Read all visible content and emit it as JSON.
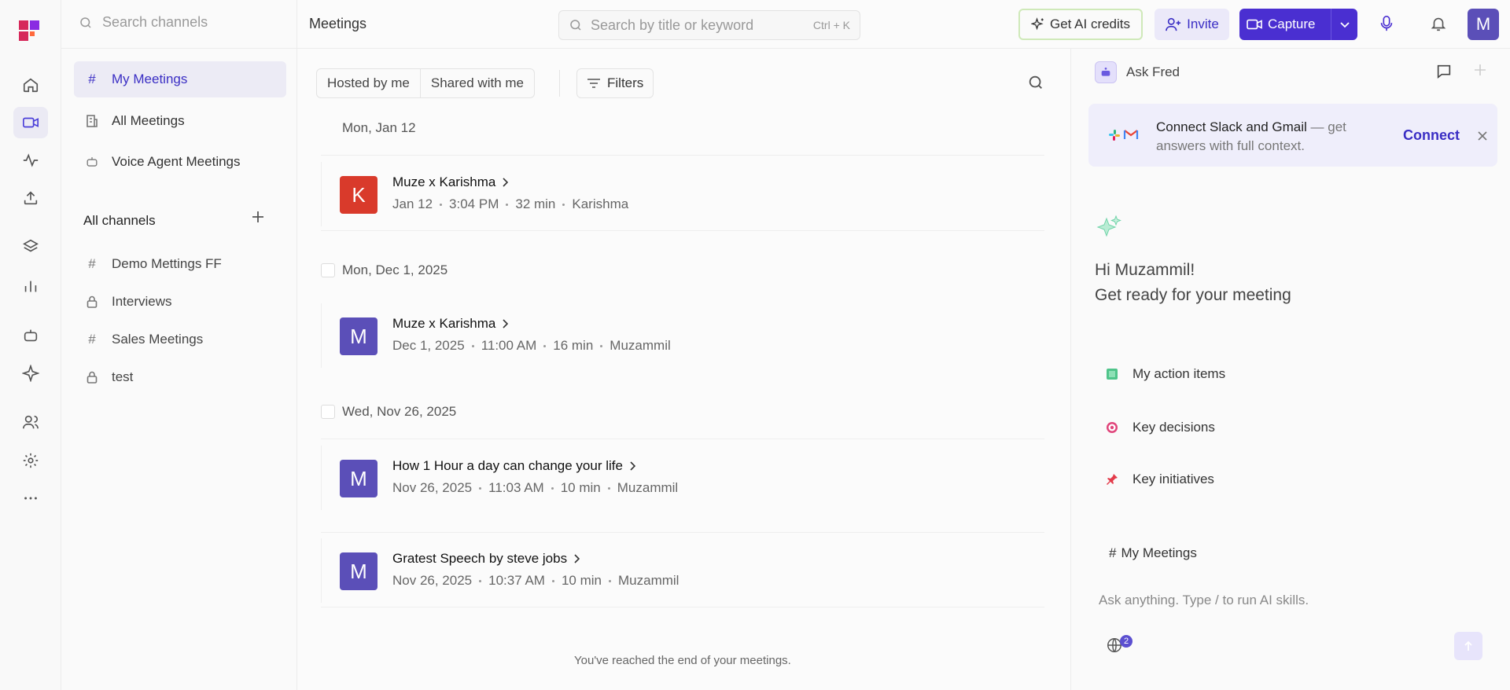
{
  "channels_panel": {
    "search_placeholder": "Search channels",
    "nav": [
      {
        "label": "My Meetings"
      },
      {
        "label": "All Meetings"
      },
      {
        "label": "Voice Agent Meetings"
      }
    ],
    "all_channels_label": "All channels",
    "channels": [
      {
        "label": "Demo Mettings FF",
        "icon": "hash-icon"
      },
      {
        "label": "Interviews",
        "icon": "lock-icon"
      },
      {
        "label": "Sales Meetings",
        "icon": "hash-icon"
      },
      {
        "label": "test",
        "icon": "lock-icon"
      }
    ]
  },
  "topbar": {
    "title": "Meetings",
    "search_placeholder": "Search by title or keyword",
    "search_shortcut": "Ctrl + K",
    "credits_label": "Get AI credits",
    "invite_label": "Invite",
    "capture_label": "Capture",
    "avatar_initial": "M"
  },
  "list": {
    "tab_hosted": "Hosted by me",
    "tab_shared": "Shared with me",
    "filters_label": "Filters",
    "groups": [
      {
        "date": "Mon, Jan 12",
        "meetings": [
          {
            "initial": "K",
            "color": "#d93a2b",
            "title": "Muze x Karishma",
            "date": "Jan 12",
            "time": "3:04 PM",
            "duration": "32 min",
            "host": "Karishma"
          }
        ]
      },
      {
        "date": "Mon, Dec 1, 2025",
        "meetings": [
          {
            "initial": "M",
            "color": "#5b4fb8",
            "title": "Muze x Karishma",
            "date": "Dec 1, 2025",
            "time": "11:00 AM",
            "duration": "16 min",
            "host": "Muzammil"
          }
        ]
      },
      {
        "date": "Wed, Nov 26, 2025",
        "meetings": [
          {
            "initial": "M",
            "color": "#5b4fb8",
            "title": "How 1 Hour a day can change your life",
            "date": "Nov 26, 2025",
            "time": "11:03 AM",
            "duration": "10 min",
            "host": "Muzammil"
          },
          {
            "initial": "M",
            "color": "#5b4fb8",
            "title": "Gratest Speech by steve jobs",
            "date": "Nov 26, 2025",
            "time": "10:37 AM",
            "duration": "10 min",
            "host": "Muzammil"
          }
        ]
      }
    ],
    "end_text": "You've reached the end of your meetings."
  },
  "assistant": {
    "title": "Ask Fred",
    "connect_title": "Connect Slack and Gmail",
    "connect_desc": " — get answers with full context.",
    "connect_button": "Connect",
    "greeting_line1": "Hi Muzammil!",
    "greeting_line2": "Get ready for your meeting",
    "skills": [
      {
        "label": "My action items",
        "icon": "green-box-icon"
      },
      {
        "label": "Key decisions",
        "icon": "target-icon"
      },
      {
        "label": "Key initiatives",
        "icon": "pushpin-icon"
      }
    ],
    "context_label": "My Meetings",
    "input_placeholder": "Ask anything. Type / to run AI skills.",
    "source_count": "2"
  },
  "colors": {
    "accent": "#4a2fd1",
    "active_bg": "#ecebf5"
  }
}
